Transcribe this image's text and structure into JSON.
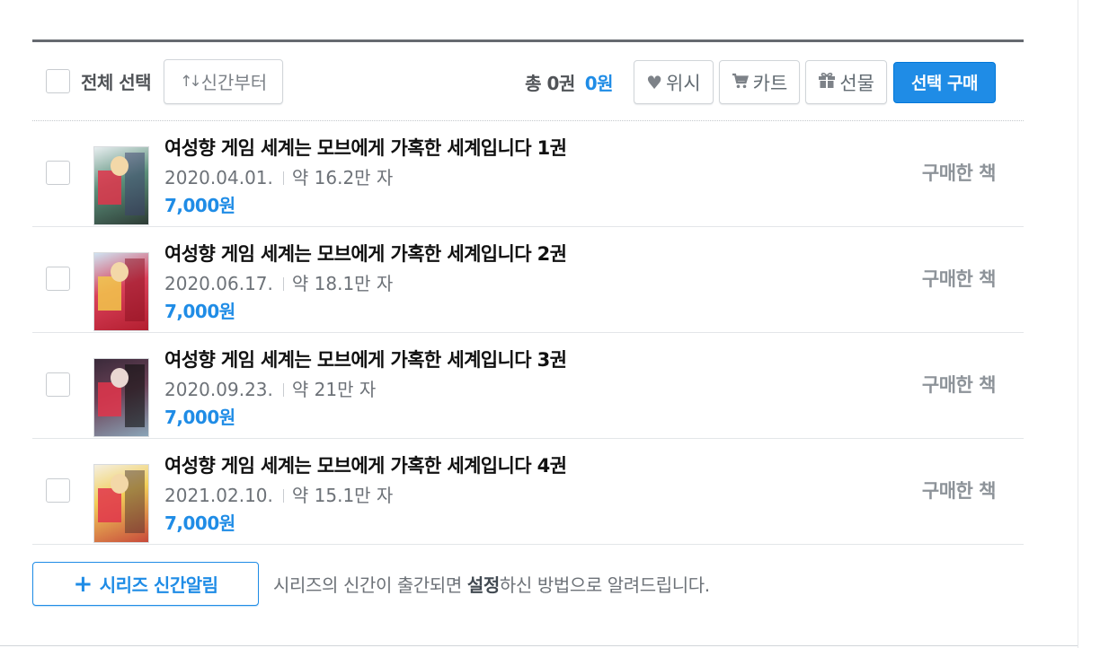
{
  "toolbar": {
    "select_all_label": "전체 선택",
    "sort_label": "신간부터",
    "sort_icon": "sort-arrows-icon",
    "total_count": "총 0권",
    "total_price": "0원",
    "wishlist_label": "위시",
    "cart_label": "카트",
    "gift_label": "선물",
    "buy_selected_label": "선택 구매"
  },
  "books": [
    {
      "title": "여성향 게임 세계는 모브에게 가혹한 세계입니다 1권",
      "date": "2020.04.01.",
      "length": "약 16.2만 자",
      "price": "7,000원",
      "status": "구매한 책"
    },
    {
      "title": "여성향 게임 세계는 모브에게 가혹한 세계입니다 2권",
      "date": "2020.06.17.",
      "length": "약 18.1만 자",
      "price": "7,000원",
      "status": "구매한 책"
    },
    {
      "title": "여성향 게임 세계는 모브에게 가혹한 세계입니다 3권",
      "date": "2020.09.23.",
      "length": "약 21만 자",
      "price": "7,000원",
      "status": "구매한 책"
    },
    {
      "title": "여성향 게임 세계는 모브에게 가혹한 세계입니다 4권",
      "date": "2021.02.10.",
      "length": "약 15.1만 자",
      "price": "7,000원",
      "status": "구매한 책"
    }
  ],
  "notify": {
    "button_label": "시리즈 신간알림",
    "text_before": "시리즈의 신간이 출간되면 ",
    "text_bold": "설정",
    "text_after": "하신 방법으로 알려드립니다."
  },
  "colors": {
    "accent": "#1f8ce6",
    "owned_text": "#8d9399"
  }
}
